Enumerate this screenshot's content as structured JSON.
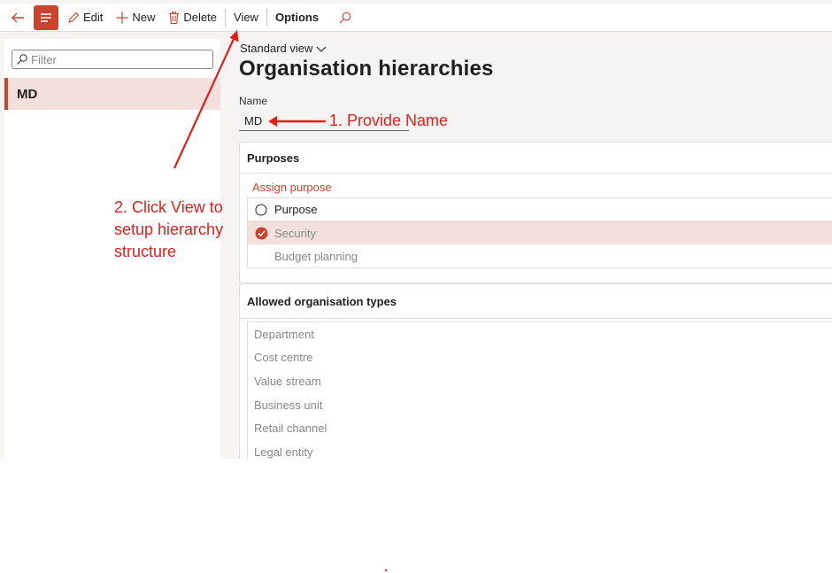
{
  "toolbar": {
    "edit_label": "Edit",
    "new_label": "New",
    "delete_label": "Delete",
    "view_label": "View",
    "options_label": "Options"
  },
  "filter": {
    "placeholder": "Filter"
  },
  "list": {
    "items": [
      {
        "label": "MD"
      }
    ]
  },
  "main": {
    "view_selector": "Standard view",
    "title": "Organisation hierarchies",
    "name_label": "Name",
    "name_value": "MD"
  },
  "purposes": {
    "header": "Purposes",
    "assign_link": "Assign purpose",
    "column_header": "Purpose",
    "rows": [
      "Security",
      "Budget planning"
    ]
  },
  "org_types": {
    "header": "Allowed organisation types",
    "items": [
      "Department",
      "Cost centre",
      "Value stream",
      "Business unit",
      "Retail channel",
      "Legal entity"
    ]
  },
  "annotations": {
    "step1": "1. Provide Name",
    "step2_lines": [
      "2. Click View to",
      "setup hierarchy",
      "structure"
    ]
  },
  "colors": {
    "accent": "#c8442e",
    "annotation": "#e0201c",
    "selected_bg": "#f3e0dd"
  }
}
